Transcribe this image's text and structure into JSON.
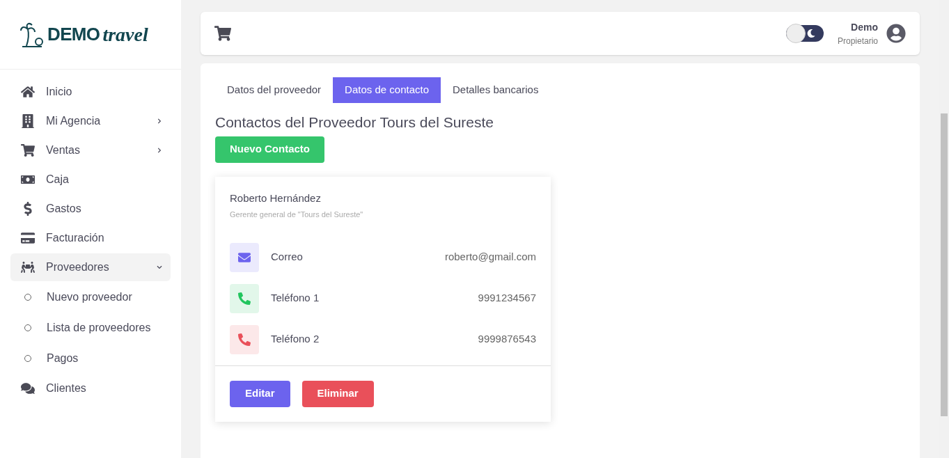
{
  "logo": {
    "word": "DEMO",
    "script": "travel"
  },
  "sidebar": {
    "items": [
      {
        "label": "Inicio",
        "selected": false
      },
      {
        "label": "Mi Agencia",
        "selected": false,
        "expanded": false
      },
      {
        "label": "Ventas",
        "selected": false,
        "expanded": false
      },
      {
        "label": "Caja",
        "selected": false
      },
      {
        "label": "Gastos",
        "selected": false
      },
      {
        "label": "Facturación",
        "selected": false
      },
      {
        "label": "Proveedores",
        "selected": true,
        "expanded": true,
        "children": [
          {
            "label": "Nuevo proveedor"
          },
          {
            "label": "Lista de proveedores"
          },
          {
            "label": "Pagos"
          }
        ]
      },
      {
        "label": "Clientes",
        "selected": false
      }
    ]
  },
  "header": {
    "dark_mode": false,
    "user": {
      "name": "Demo",
      "role": "Propietario"
    }
  },
  "tabs": [
    {
      "label": "Datos del proveedor",
      "selected": false
    },
    {
      "label": "Datos de contacto",
      "selected": true
    },
    {
      "label": "Detalles bancarios",
      "selected": false
    }
  ],
  "heading": "Contactos del Proveedor Tours del Sureste",
  "new_button": "Nuevo Contacto",
  "contact": {
    "name": "Roberto Hernández",
    "subtitle": "Gerente general de \"Tours del Sureste\"",
    "methods": [
      {
        "kind": "email",
        "label": "Correo",
        "value": "roberto@gmail.com",
        "color": "#6c63ee"
      },
      {
        "kind": "phone",
        "label": "Teléfono 1",
        "value": "9991234567",
        "color": "#22c55e"
      },
      {
        "kind": "phone",
        "label": "Teléfono 2",
        "value": "9999876543",
        "color": "#e9505a"
      }
    ],
    "buttons": [
      {
        "kind": "edit",
        "label": "Editar"
      },
      {
        "kind": "delete",
        "label": "Eliminar"
      }
    ]
  }
}
